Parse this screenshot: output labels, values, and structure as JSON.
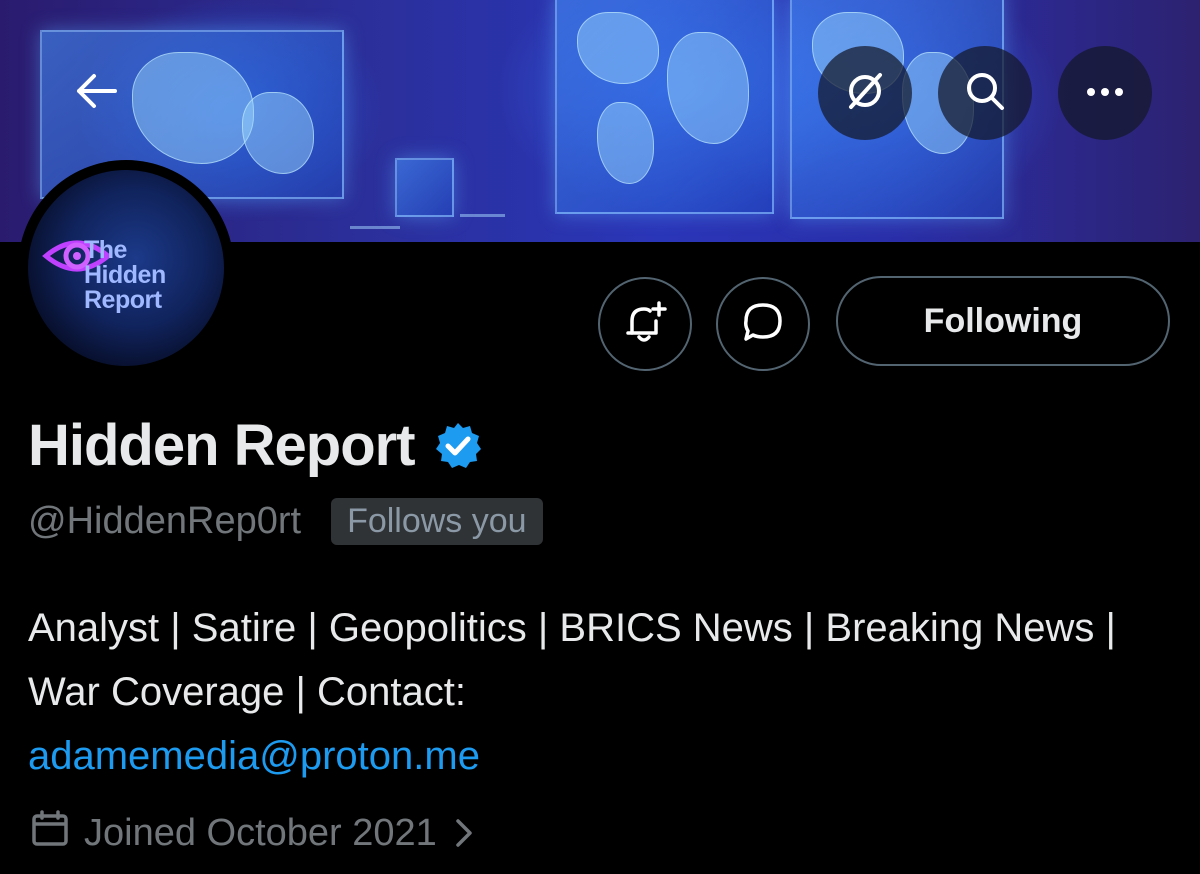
{
  "header": {
    "back_icon": "arrow-left-icon",
    "grok_icon": "grok-icon",
    "search_icon": "search-icon",
    "more_icon": "more-horizontal-icon"
  },
  "avatar": {
    "logo_lines": [
      "The",
      "Hidden",
      "Report"
    ]
  },
  "actions": {
    "notify_icon": "bell-plus-icon",
    "message_icon": "message-bubble-icon",
    "following_label": "Following"
  },
  "profile": {
    "name": "Hidden Report",
    "verified": true,
    "handle": "@HiddenRep0rt",
    "follows_you_label": "Follows you",
    "bio_text": "Analyst | Satire | Geopolitics | BRICS News | Breaking News | War Coverage | Contact:",
    "bio_email": "adamemedia@proton.me",
    "joined": "Joined October 2021"
  },
  "colors": {
    "background": "#000000",
    "text_primary": "#e7e9ea",
    "text_secondary": "#71767b",
    "link": "#1d9bf0",
    "verified_badge": "#1d9bf0",
    "border": "#536471"
  }
}
